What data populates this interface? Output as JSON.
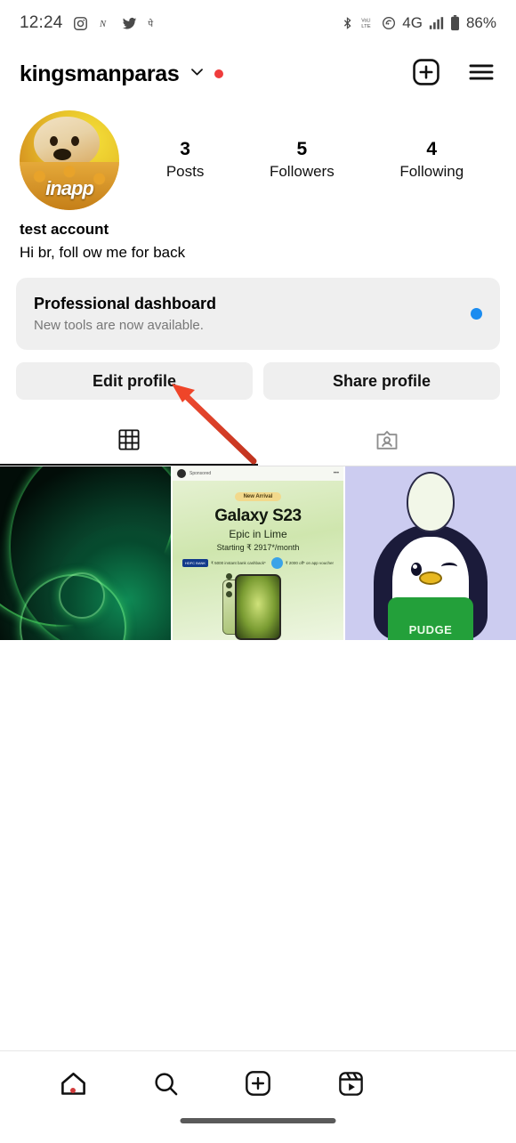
{
  "status_bar": {
    "time": "12:24",
    "network_type": "4G",
    "battery_percent": "86%",
    "left_icons": [
      "instagram-icon",
      "n-app-icon",
      "twitter-icon",
      "phonepe-icon"
    ],
    "right_icons": [
      "bluetooth-icon",
      "volte-icon",
      "wifi-calling-icon",
      "signal-bars-icon",
      "battery-icon"
    ]
  },
  "app_bar": {
    "username": "kingsmanparas",
    "chevron": "chevron-down-icon",
    "has_unread_dot": true,
    "create_label": "add-post-icon",
    "menu_label": "hamburger-menu-icon"
  },
  "profile": {
    "avatar_watermark": "inapp",
    "display_name": "test account",
    "bio": "Hi br, foll ow me for back",
    "stats": [
      {
        "value": "3",
        "label": "Posts"
      },
      {
        "value": "5",
        "label": "Followers"
      },
      {
        "value": "4",
        "label": "Following"
      }
    ]
  },
  "dashboard": {
    "title": "Professional dashboard",
    "subtitle": "New tools are now available.",
    "dot_color": "#1b8cf0"
  },
  "actions": {
    "edit_profile": "Edit profile",
    "share_profile": "Share profile"
  },
  "tabs": [
    {
      "name": "grid-tab",
      "icon": "grid-icon",
      "active": true
    },
    {
      "name": "tagged-tab",
      "icon": "tagged-person-icon",
      "active": false
    }
  ],
  "posts": [
    {
      "name": "post-abstract-green",
      "description": "dark green abstract wallpaper"
    },
    {
      "name": "post-galaxy-s23-ad",
      "sponsored_label": "Sponsored",
      "badge": "New Arrival",
      "headline": "Galaxy S23",
      "subhead": "Epic in Lime",
      "price_line": "Starting ₹ 2917*/month",
      "offer_bank": "HDFC BANK",
      "offer_bank_text": "₹ 5000 instant bank cashback*",
      "offer_voucher_text": "₹ 2000 off* on app voucher"
    },
    {
      "name": "post-pudge-penguin",
      "apron_text": "PUDGE"
    }
  ],
  "annotation": {
    "arrow_color": "#e8402a",
    "points_to": "Edit profile"
  },
  "bottom_nav": [
    {
      "name": "nav-home",
      "icon": "home-icon",
      "has_dot": true
    },
    {
      "name": "nav-search",
      "icon": "search-icon",
      "has_dot": false
    },
    {
      "name": "nav-create",
      "icon": "add-box-icon",
      "has_dot": false
    },
    {
      "name": "nav-reels",
      "icon": "reels-icon",
      "has_dot": false
    }
  ]
}
